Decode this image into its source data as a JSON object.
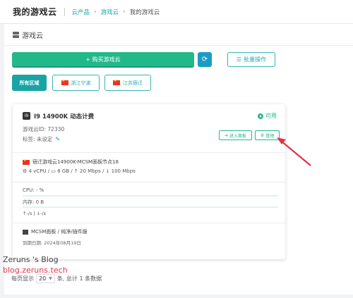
{
  "header": {
    "title": "我的游戏云",
    "breadcrumbs": [
      "云产品",
      "游戏云",
      "我的游戏云"
    ]
  },
  "panel": {
    "title": "游戏云",
    "buy_label": "+ 购买游戏云",
    "refresh_icon": "refresh-icon",
    "batch_label": "批量操作"
  },
  "regions": [
    {
      "label": "所有区域"
    },
    {
      "label": "浙江宁波"
    },
    {
      "label": "江苏宿迁"
    }
  ],
  "server": {
    "cpu_badge": "i9",
    "name": "I9 14900K 动态计费",
    "status": "可用",
    "id_text": "游戏云ID: 72330",
    "tag_text": "标签: 未设定",
    "enter_label": "进入面板",
    "manage_label": "管理",
    "node": "宿迁游戏云14900K-MCSM面板节点18",
    "specs": "4 vCPU / ▭ 8 GB / ↑ 20 Mbps / ↓ 100 Mbps",
    "cpu_label": "CPU: - %",
    "mem_label": "内存: 0 B",
    "net_text": "↑-/s  |  ↓-/s",
    "panel_text": "MCSM面板 / 纯净/插件服",
    "expire_text": "到期日期: 2024年08月19日"
  },
  "pagination": {
    "prefix": "每页显示",
    "size": "20",
    "suffix": "条, 总计 1 条数据"
  },
  "watermark": {
    "line1": "Zeruns 's Blog",
    "line2": "blog.zeruns.tech"
  },
  "colors": {
    "accent": "#1aa3a3",
    "success": "#22b88a",
    "arrow": "#e0334a"
  }
}
